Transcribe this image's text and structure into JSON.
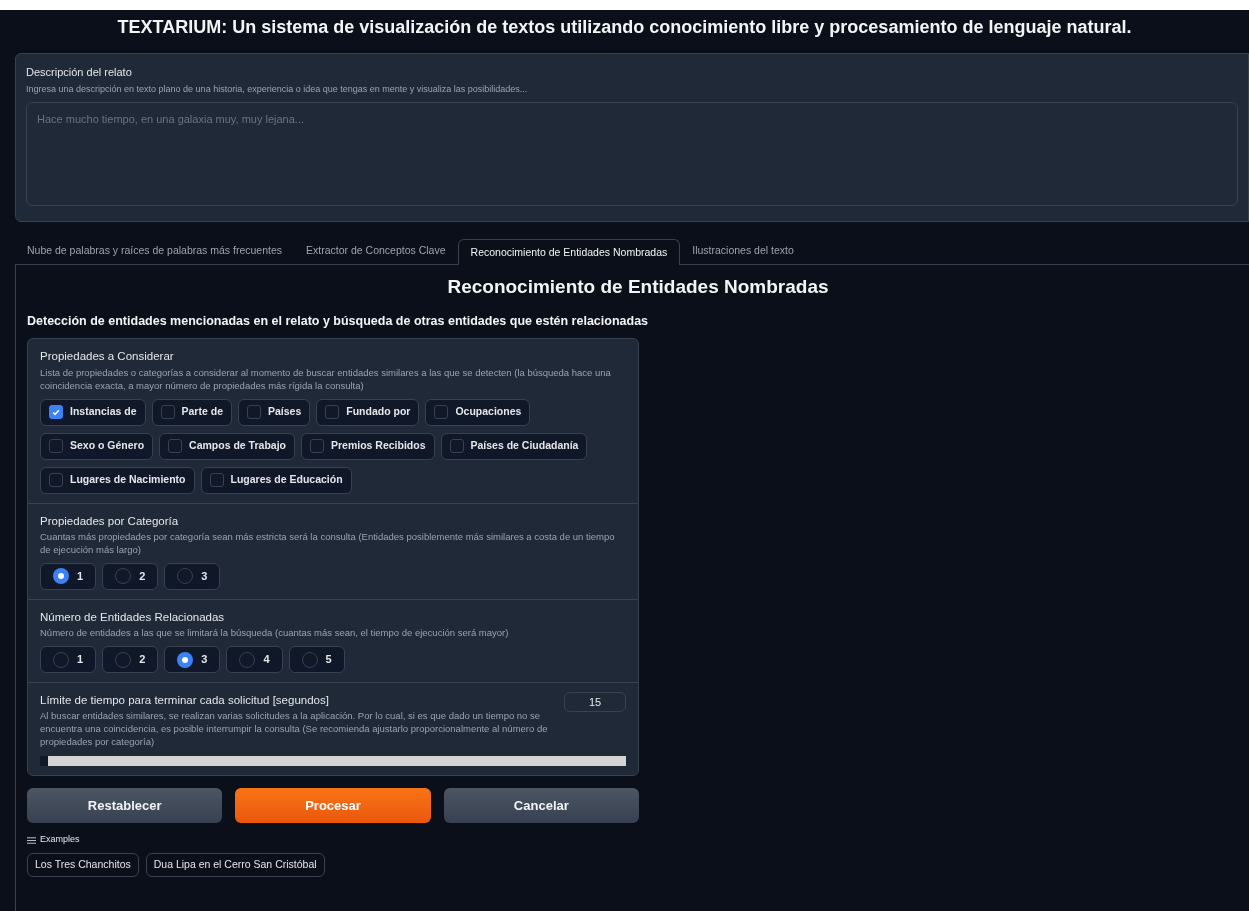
{
  "title": "TEXTARIUM: Un sistema de visualización de textos utilizando conocimiento libre y procesamiento de lenguaje natural.",
  "description": {
    "label": "Descripción del relato",
    "info": "Ingresa una descripción en texto plano de una historia, experiencia o idea que tengas en mente y visualiza las posibilidades...",
    "placeholder": "Hace mucho tiempo, en una galaxia muy, muy lejana..."
  },
  "tabs": [
    {
      "label": "Nube de palabras y raíces de palabras más frecuentes",
      "selected": false
    },
    {
      "label": "Extractor de Conceptos Clave",
      "selected": false
    },
    {
      "label": "Reconocimiento de Entidades Nombradas",
      "selected": true
    },
    {
      "label": "Ilustraciones del texto",
      "selected": false
    }
  ],
  "panel": {
    "heading": "Reconocimiento de Entidades Nombradas",
    "subheading": "Detección de entidades mencionadas en el relato y búsqueda de otras entidades que estén relacionadas",
    "properties": {
      "label": "Propiedades a Considerar",
      "info": "Lista de propiedades o categorías a considerar al momento de buscar entidades similares a las que se detecten (la búsqueda hace una coincidencia exacta, a mayor número de propiedades más rígida la consulta)",
      "options": [
        {
          "label": "Instancias de",
          "checked": true
        },
        {
          "label": "Parte de",
          "checked": false
        },
        {
          "label": "Países",
          "checked": false
        },
        {
          "label": "Fundado por",
          "checked": false
        },
        {
          "label": "Ocupaciones",
          "checked": false
        },
        {
          "label": "Sexo o Género",
          "checked": false
        },
        {
          "label": "Campos de Trabajo",
          "checked": false
        },
        {
          "label": "Premios Recibidos",
          "checked": false
        },
        {
          "label": "Países de Ciudadanía",
          "checked": false
        },
        {
          "label": "Lugares de Nacimiento",
          "checked": false
        },
        {
          "label": "Lugares de Educación",
          "checked": false
        }
      ]
    },
    "per_category": {
      "label": "Propiedades por Categoría",
      "info": "Cuantas más propiedades por categoría sean más estricta será la consulta (Entidades posiblemente más similares a costa de un tiempo de ejecución más largo)",
      "options": [
        {
          "label": "1",
          "selected": true
        },
        {
          "label": "2",
          "selected": false
        },
        {
          "label": "3",
          "selected": false
        }
      ]
    },
    "related": {
      "label": "Número de Entidades Relacionadas",
      "info": "Número de entidades a las que se limitará la búsqueda (cuantas más sean, el tiempo de ejecución será mayor)",
      "options": [
        {
          "label": "1",
          "selected": false
        },
        {
          "label": "2",
          "selected": false
        },
        {
          "label": "3",
          "selected": true
        },
        {
          "label": "4",
          "selected": false
        },
        {
          "label": "5",
          "selected": false
        }
      ]
    },
    "timeout": {
      "label": "Límite de tiempo para terminar cada solicitud [segundos]",
      "info": "Al buscar entidades similares, se realizan varias solicitudes a la aplicación. Por lo cual, si es que dado un tiempo no se encuentra una coincidencia, es posible interrumpir la consulta (Se recomienda ajustarlo proporcionalmente al número de propiedades por categoría)",
      "value": "15",
      "level": 0.0
    },
    "buttons": [
      {
        "label": "Restablecer",
        "kind": "secondary"
      },
      {
        "label": "Procesar",
        "kind": "primary"
      },
      {
        "label": "Cancelar",
        "kind": "secondary"
      }
    ],
    "examples": {
      "label": "Examples",
      "items": [
        "Los Tres Chanchitos",
        "Dua Lipa en el Cerro San Cristóbal"
      ]
    }
  }
}
